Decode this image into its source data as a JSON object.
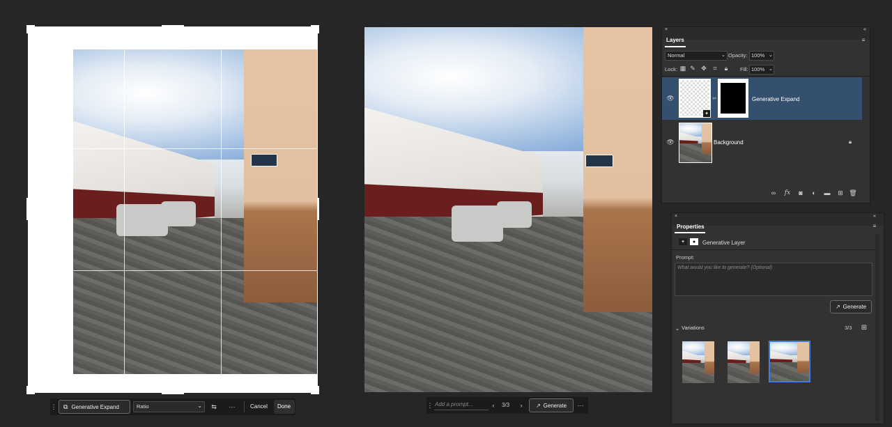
{
  "crop_toolbar": {
    "generative_expand_label": "Generative Expand",
    "ratio_value": "Ratio",
    "cancel_label": "Cancel",
    "done_label": "Done",
    "more_icon": "more-horizontal-icon"
  },
  "prompt_bar": {
    "placeholder": "Add a prompt...",
    "counter": "3/3",
    "generate_label": "Generate"
  },
  "layers_panel": {
    "tab_label": "Layers",
    "blend_mode": "Normal",
    "opacity_label": "Opacity:",
    "opacity_value": "100%",
    "lock_label": "Lock:",
    "fill_label": "Fill:",
    "fill_value": "100%",
    "layers": [
      {
        "name": "Generative Expand",
        "selected": true
      },
      {
        "name": "Background",
        "selected": false
      }
    ]
  },
  "properties_panel": {
    "tab_label": "Properties",
    "layer_type": "Generative Layer",
    "prompt_label": "Prompt:",
    "prompt_placeholder": "What would you like to generate? (Optional)",
    "generate_label": "Generate",
    "variations_label": "Variations",
    "variations_count": "3/3"
  },
  "colors": {
    "selection_blue": "#34506e",
    "variation_border": "#3f7ee0"
  }
}
